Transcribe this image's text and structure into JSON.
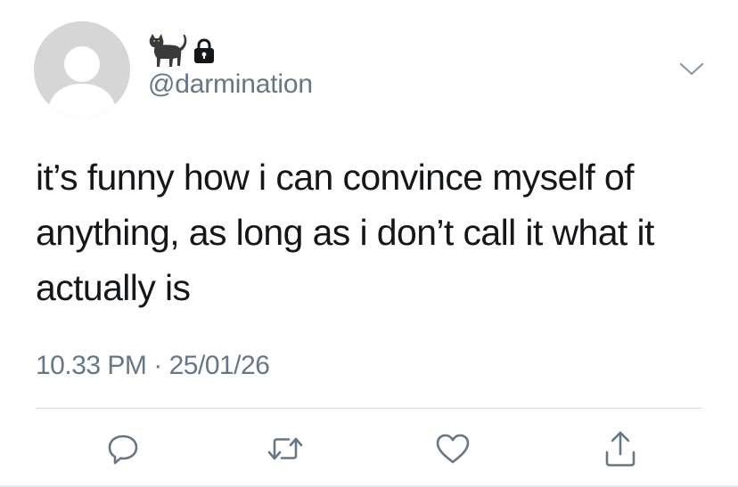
{
  "author": {
    "display_name_emoji": [
      "cat",
      "lock"
    ],
    "handle": "@darmination"
  },
  "tweet": {
    "text": "it’s funny how i can convince myself of anything, as long as i don’t call it what it actually is",
    "time": "10.33 PM",
    "separator": "·",
    "date": "25/01/26"
  },
  "actions": {
    "reply_icon": "reply-icon",
    "retweet_icon": "retweet-icon",
    "like_icon": "heart-icon",
    "share_icon": "share-icon"
  },
  "colors": {
    "text_primary": "#14171a",
    "text_secondary": "#657786",
    "avatar_bg": "#d6d6d6",
    "icon": "#657786"
  }
}
